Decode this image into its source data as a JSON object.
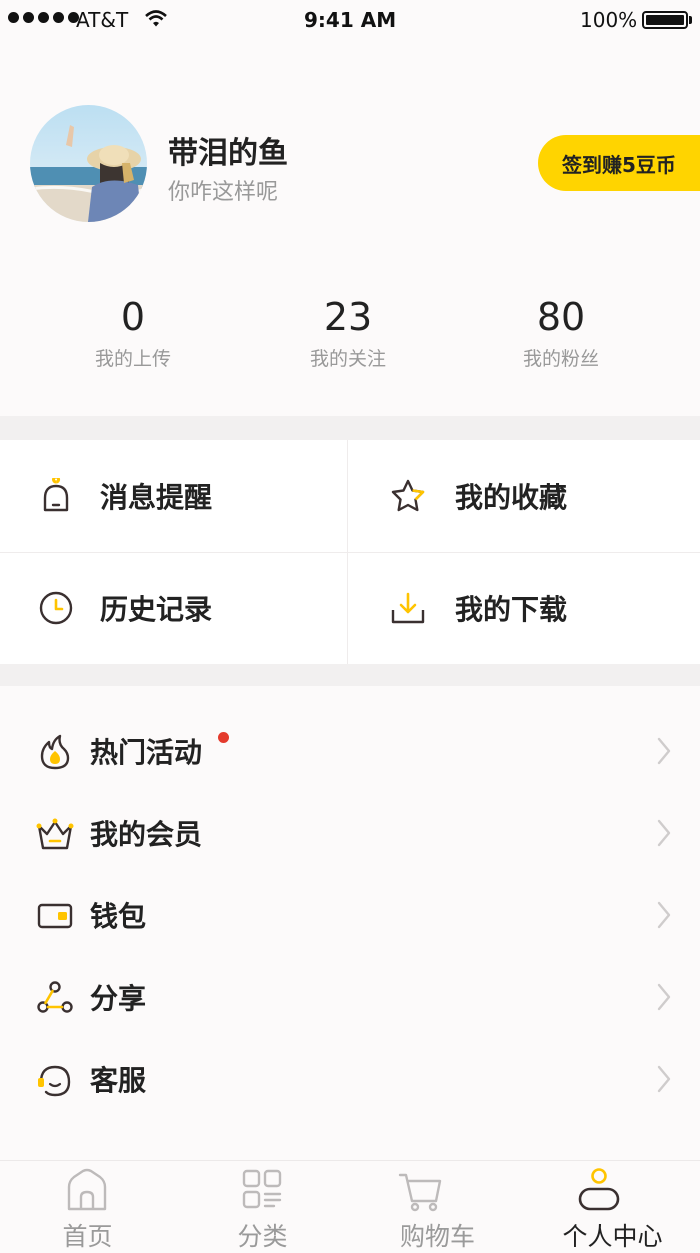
{
  "status_bar": {
    "carrier": "AT&T",
    "time": "9:41 AM",
    "battery": "100%"
  },
  "profile": {
    "name": "带泪的鱼",
    "signature": "你咋这样呢",
    "checkin_label": "签到赚5豆币"
  },
  "stats": [
    {
      "value": "0",
      "label": "我的上传"
    },
    {
      "value": "23",
      "label": "我的关注"
    },
    {
      "value": "80",
      "label": "我的粉丝"
    }
  ],
  "grid": [
    {
      "label": "消息提醒",
      "icon": "bell-icon"
    },
    {
      "label": "我的收藏",
      "icon": "star-icon"
    },
    {
      "label": "历史记录",
      "icon": "clock-icon"
    },
    {
      "label": "我的下载",
      "icon": "download-icon"
    }
  ],
  "menu": [
    {
      "label": "热门活动",
      "icon": "flame-icon",
      "badge": true
    },
    {
      "label": "我的会员",
      "icon": "crown-icon"
    },
    {
      "label": "钱包",
      "icon": "wallet-icon"
    },
    {
      "label": "分享",
      "icon": "share-icon"
    },
    {
      "label": "客服",
      "icon": "headset-icon"
    }
  ],
  "tabs": [
    {
      "label": "首页",
      "icon": "home-icon"
    },
    {
      "label": "分类",
      "icon": "category-icon"
    },
    {
      "label": "购物车",
      "icon": "cart-icon"
    },
    {
      "label": "个人中心",
      "icon": "user-icon",
      "active": true
    }
  ],
  "colors": {
    "accent": "#ffd400",
    "badge": "#e43a2c",
    "icon_stroke": "#3a3030"
  }
}
